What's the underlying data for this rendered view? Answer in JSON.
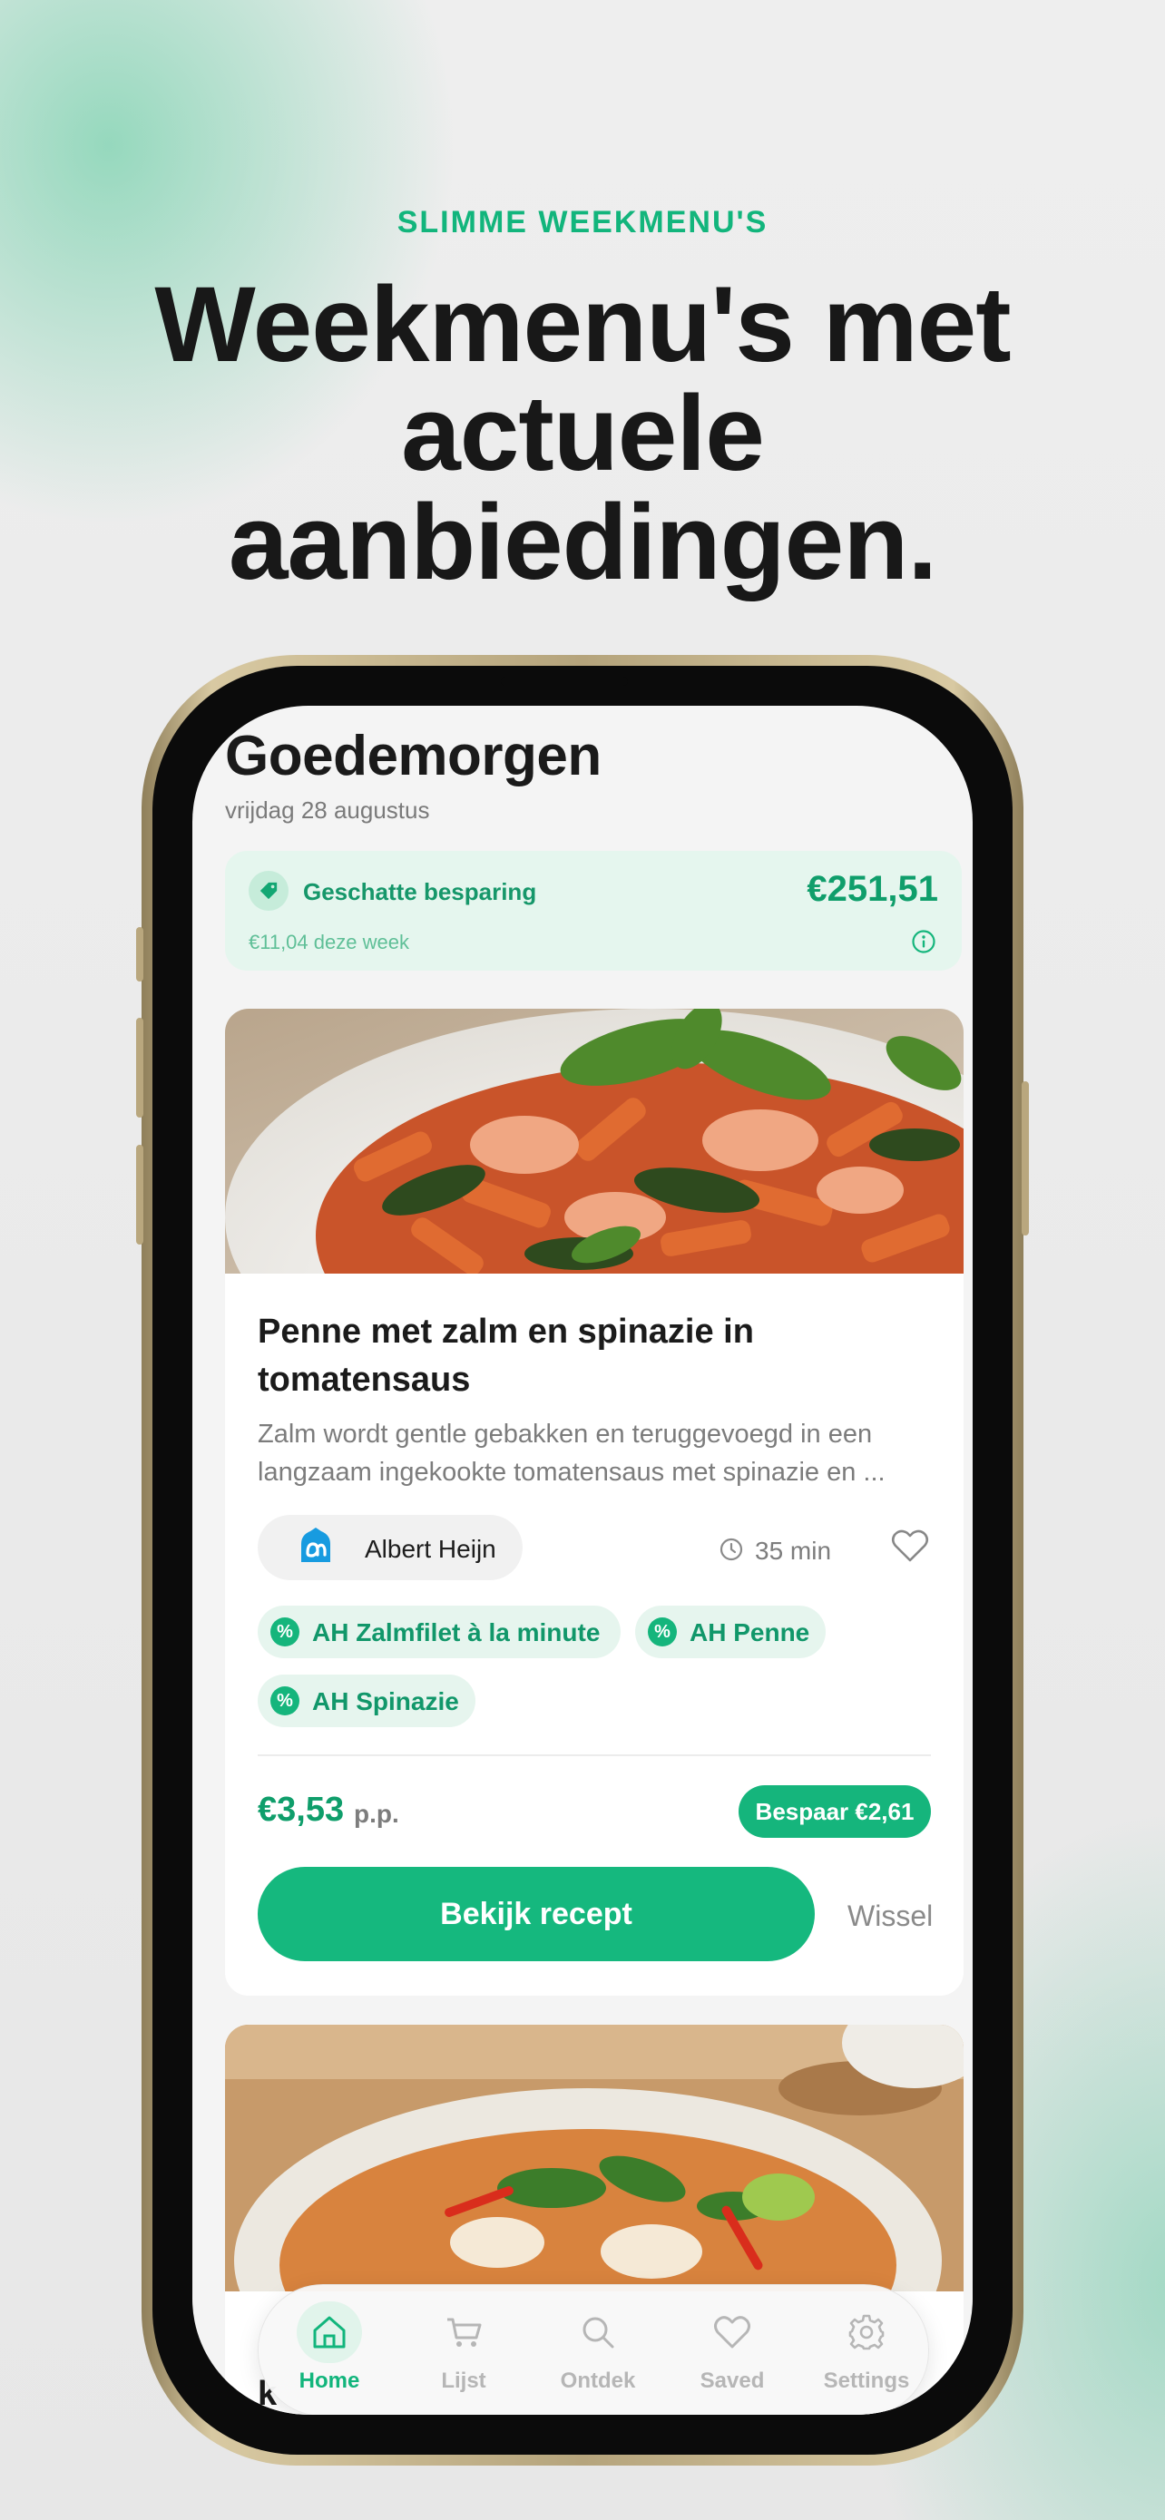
{
  "hero": {
    "eyebrow": "SLIMME WEEKMENU'S",
    "headline_line1": "Weekmenu's met",
    "headline_line2": "actuele",
    "headline_line3": "aanbiedingen."
  },
  "app": {
    "greeting": "Goedemorgen",
    "date": "vrijdag 28 augustus",
    "savings": {
      "label": "Geschatte besparing",
      "amount": "€251,51",
      "weekly": "€11,04 deze week",
      "icon": "price-tag-icon"
    },
    "recipe": {
      "title": "Penne met zalm en spinazie in tomatensaus",
      "description": "Zalm wordt gentle gebakken en teruggevoegd in een langzaam ingekookte tomatensaus met spinazie en ...",
      "store": "Albert Heijn",
      "time": "35 min",
      "offers": [
        "AH Zalmfilet à la minute",
        "AH Penne",
        "AH Spinazie"
      ],
      "offer_icon_text": "%",
      "price": "€3,53",
      "price_unit": "p.p.",
      "save_badge": "Bespaar €2,61",
      "cta": "Bekijk recept",
      "swap": "Wissel"
    },
    "next_recipe": {
      "title_partial": "k"
    },
    "tabbar": [
      {
        "label": "Home",
        "icon": "home-icon",
        "active": true
      },
      {
        "label": "Lijst",
        "icon": "cart-icon",
        "active": false
      },
      {
        "label": "Ontdek",
        "icon": "search-icon",
        "active": false
      },
      {
        "label": "Saved",
        "icon": "heart-icon",
        "active": false
      },
      {
        "label": "Settings",
        "icon": "gear-icon",
        "active": false
      }
    ]
  },
  "colors": {
    "accent": "#15B57C",
    "accent_light": "#E5F6EE",
    "text_dark": "#1A1A1A",
    "text_muted": "#7C7C7C",
    "phone_frame": "#B5A47C"
  }
}
